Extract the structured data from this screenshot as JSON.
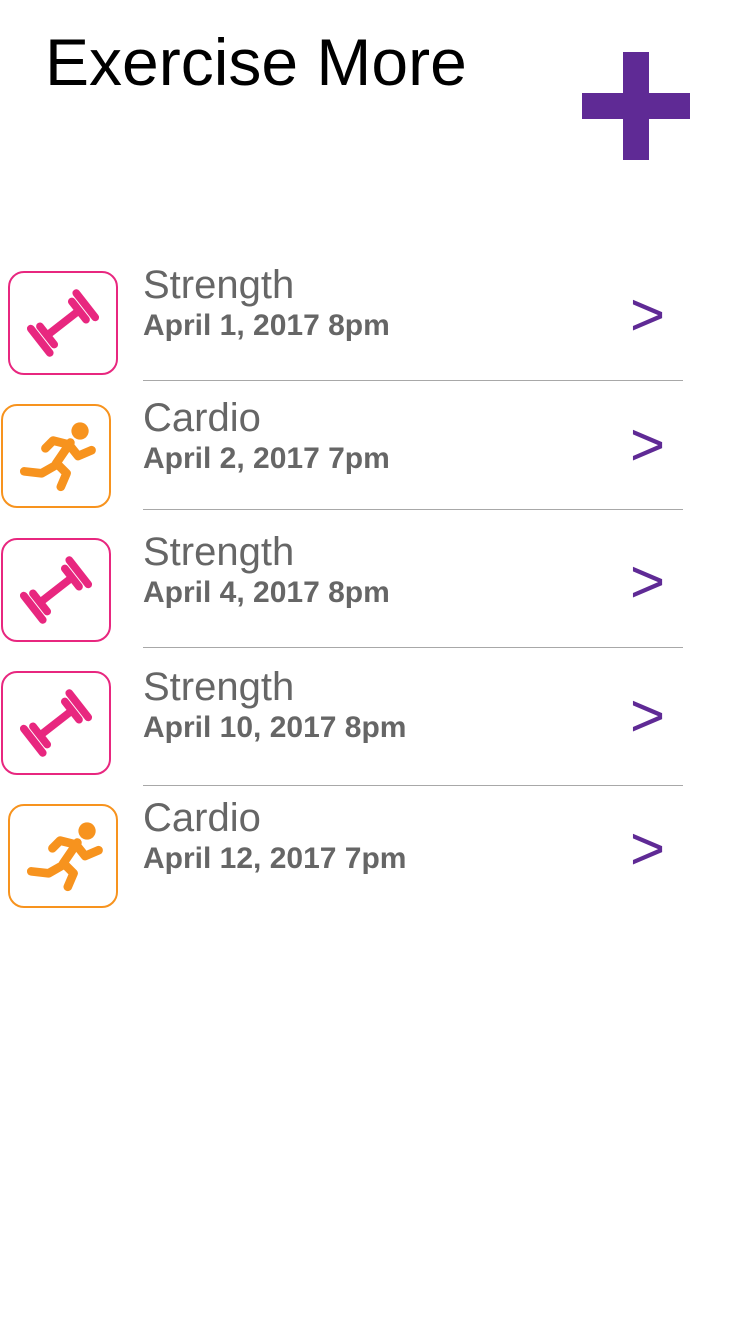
{
  "header": {
    "title": "Exercise More",
    "add_icon": "plus-icon"
  },
  "colors": {
    "accent": "#5f2a95",
    "strength": "#e8277f",
    "cardio": "#f7931e",
    "text_secondary": "#666666"
  },
  "workouts": [
    {
      "type": "Strength",
      "date": "April 1, 2017 8pm",
      "icon": "dumbbell-icon",
      "chevron": ">"
    },
    {
      "type": "Cardio",
      "date": "April 2, 2017 7pm",
      "icon": "runner-icon",
      "chevron": ">"
    },
    {
      "type": "Strength",
      "date": "April 4, 2017 8pm",
      "icon": "dumbbell-icon",
      "chevron": ">"
    },
    {
      "type": "Strength",
      "date": "April 10, 2017 8pm",
      "icon": "dumbbell-icon",
      "chevron": ">"
    },
    {
      "type": "Cardio",
      "date": "April 12, 2017 7pm",
      "icon": "runner-icon",
      "chevron": ">"
    }
  ]
}
